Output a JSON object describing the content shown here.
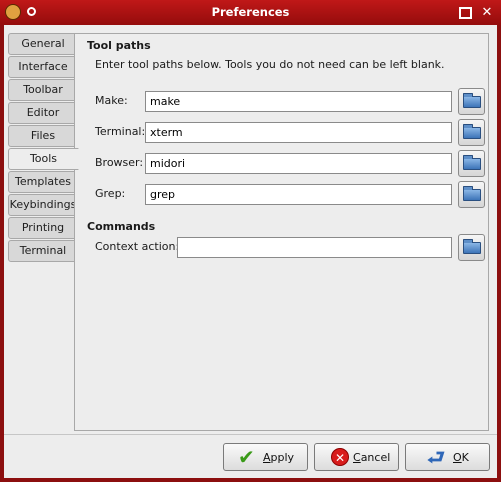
{
  "window": {
    "title": "Preferences",
    "app_icon": "geany-teapot-icon",
    "controls": {
      "pin": "●",
      "maximize": "maximize-icon",
      "close": "✕"
    }
  },
  "tabs": [
    {
      "label": "General"
    },
    {
      "label": "Interface"
    },
    {
      "label": "Toolbar"
    },
    {
      "label": "Editor"
    },
    {
      "label": "Files"
    },
    {
      "label": "Tools",
      "active": true
    },
    {
      "label": "Templates"
    },
    {
      "label": "Keybindings"
    },
    {
      "label": "Printing"
    },
    {
      "label": "Terminal"
    }
  ],
  "tool_paths": {
    "heading": "Tool paths",
    "description": "Enter tool paths below. Tools you do not need can be left blank.",
    "fields": [
      {
        "label": "Make:",
        "value": "make"
      },
      {
        "label": "Terminal:",
        "value": "xterm"
      },
      {
        "label": "Browser:",
        "value": "midori"
      },
      {
        "label": "Grep:",
        "value": "grep"
      }
    ]
  },
  "commands": {
    "heading": "Commands",
    "fields": [
      {
        "label": "Context action:",
        "value": ""
      }
    ]
  },
  "buttons": {
    "apply": {
      "mnemonic": "A",
      "rest": "pply",
      "icon": "checkmark-icon"
    },
    "cancel": {
      "mnemonic": "C",
      "rest": "ancel",
      "icon": "cancel-icon"
    },
    "ok": {
      "mnemonic": "O",
      "rest": "K",
      "icon": "ok-arrow-icon"
    }
  },
  "colors": {
    "titlebar": "#b01414",
    "frame": "#8c0f0f",
    "dialog_bg": "#ededed"
  }
}
